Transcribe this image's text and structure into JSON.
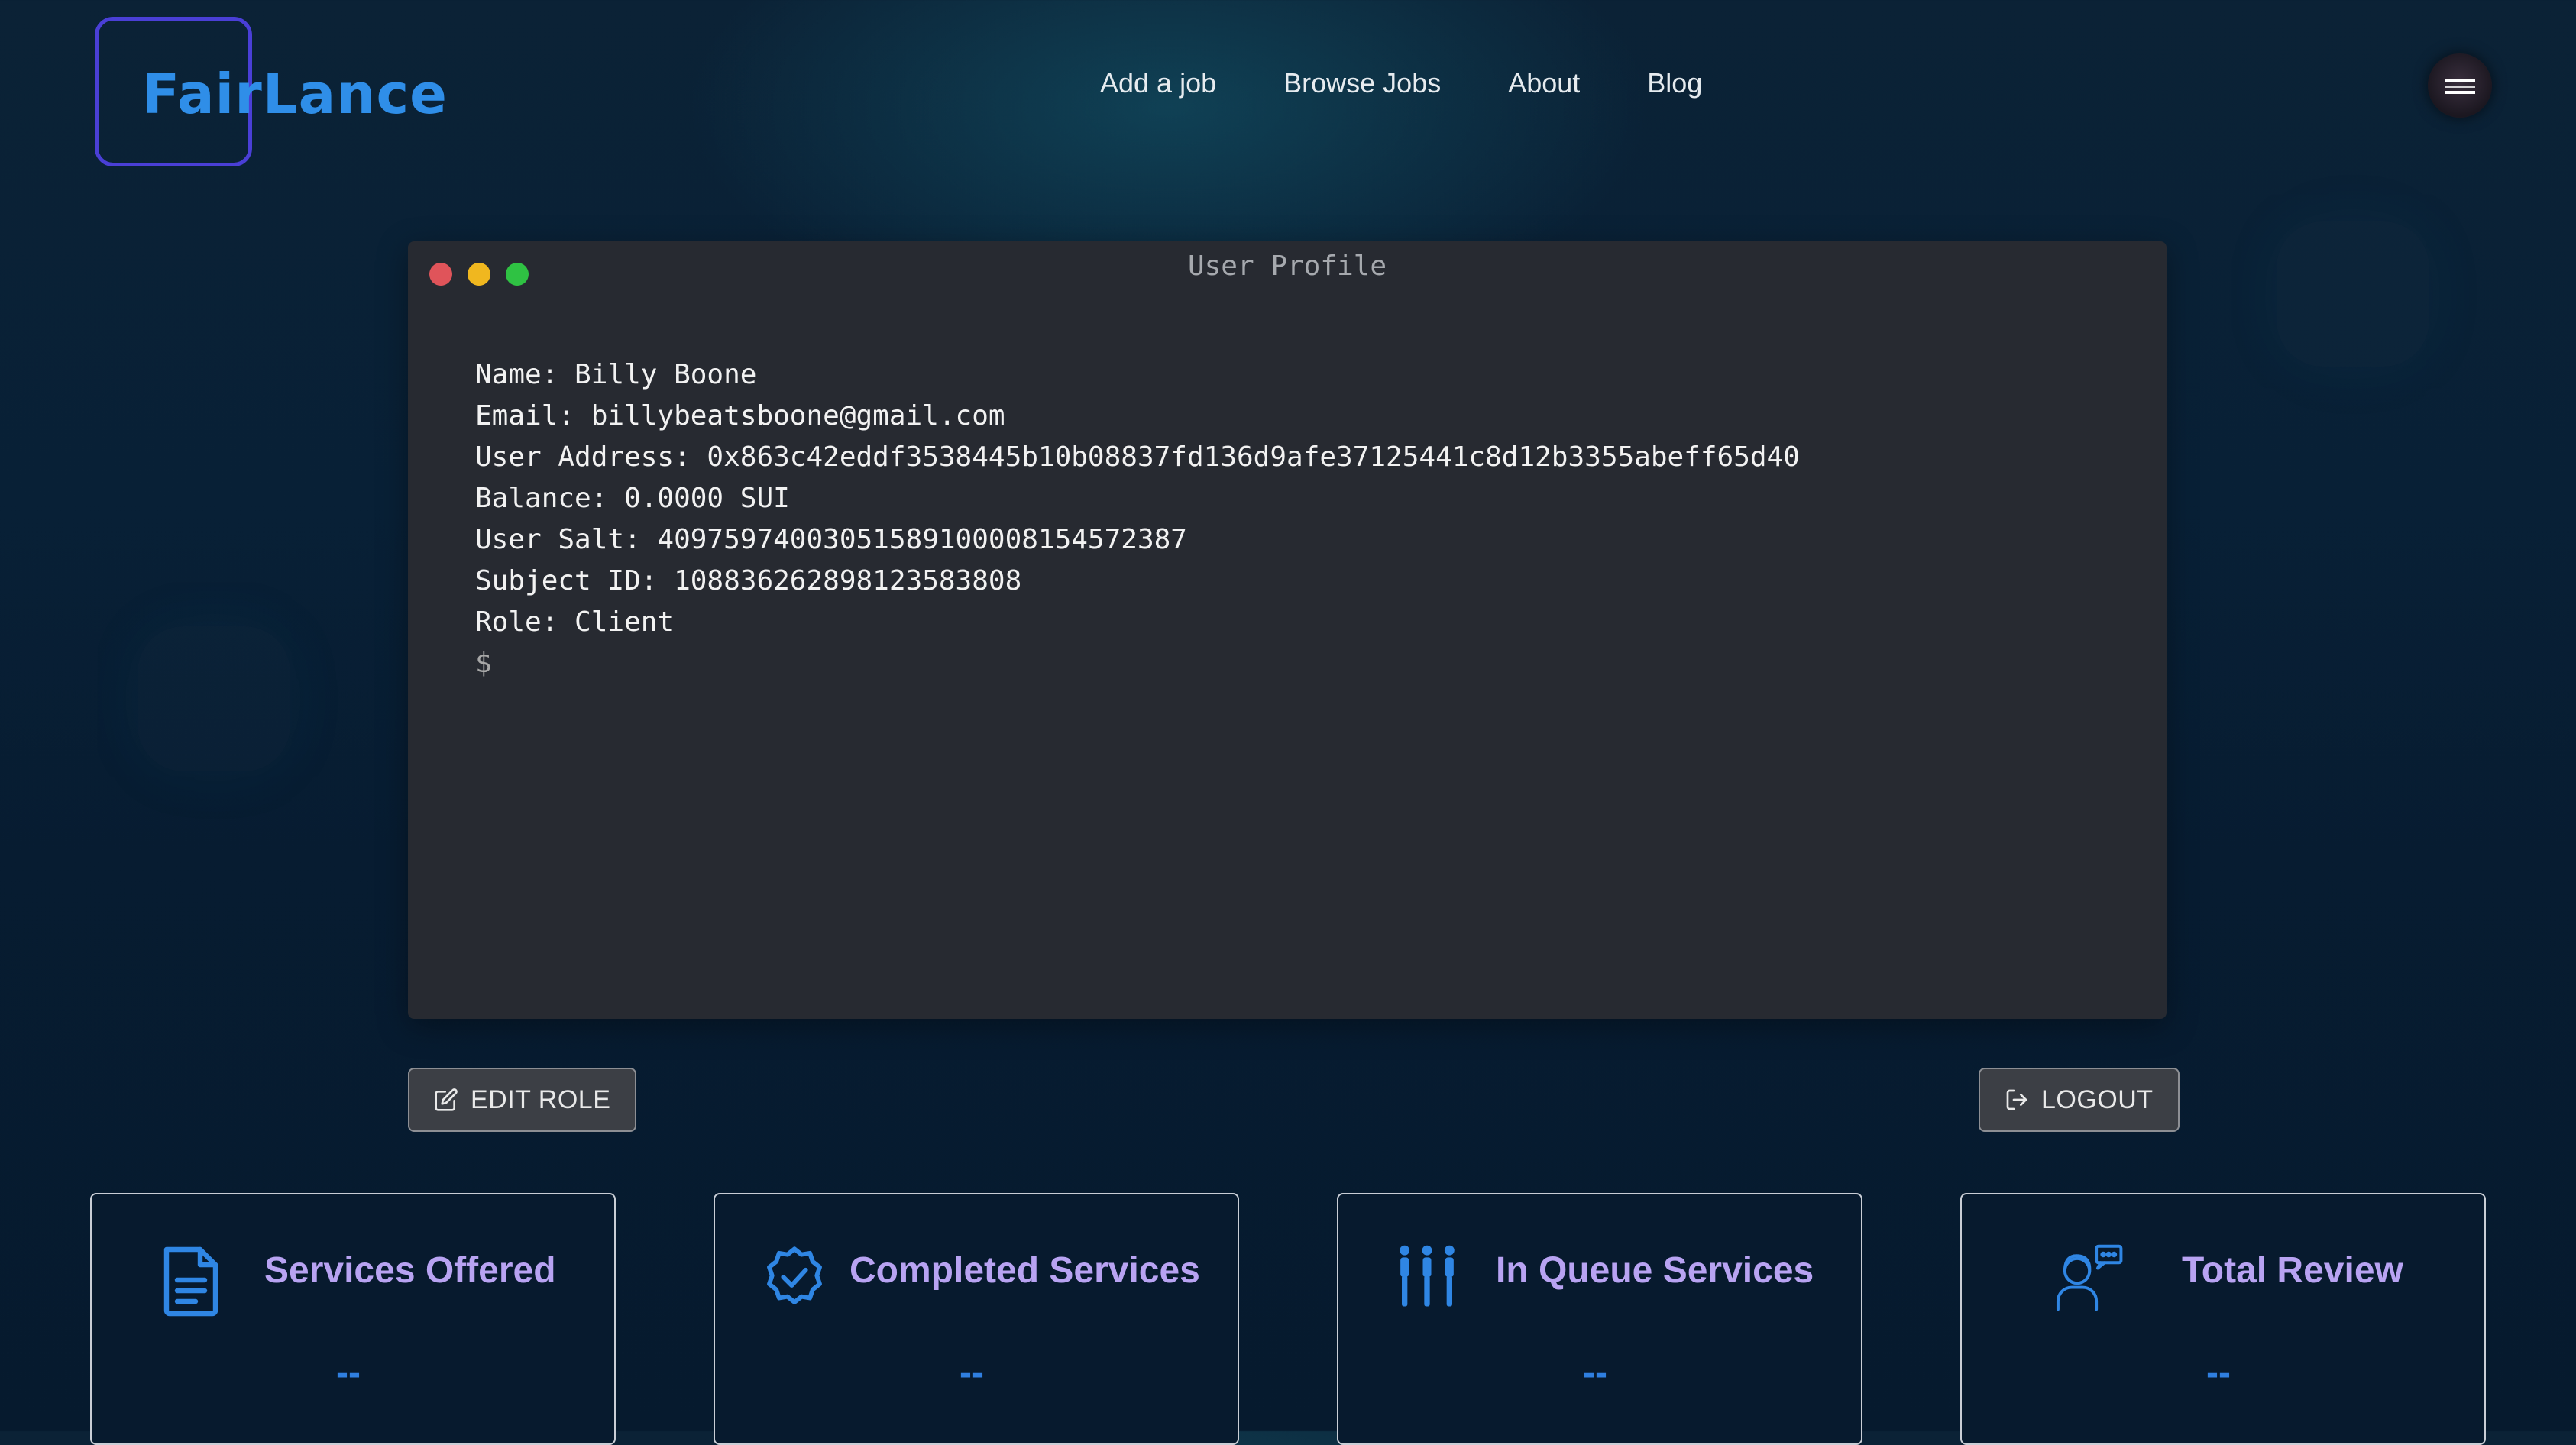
{
  "brand": {
    "name": "FairLance",
    "logo_color": "#2f8ee8",
    "frame_color": "#4a3fd6"
  },
  "nav": {
    "items": [
      {
        "label": "Add a job"
      },
      {
        "label": "Browse Jobs"
      },
      {
        "label": "About"
      },
      {
        "label": "Blog"
      }
    ]
  },
  "terminal": {
    "title": "User Profile",
    "lines": {
      "name": "Name: Billy Boone",
      "email": "Email: billybeatsboone@gmail.com",
      "address": "User Address: 0x863c42eddf3538445b10b08837fd136d9afe37125441c8d12b3355abeff65d40",
      "balance": "Balance: 0.0000 SUI",
      "salt": "User Salt: 40975974003051589100008154572387",
      "subject": "Subject ID: 108836262898123583808",
      "role": "Role: Client",
      "prompt": "$"
    },
    "window_dots": [
      "#e0545a",
      "#f0b71f",
      "#2fc243"
    ]
  },
  "actions": {
    "edit_role": "EDIT ROLE",
    "logout": "LOGOUT"
  },
  "stats": [
    {
      "title": "Services Offered",
      "value": "--",
      "icon": "document-icon"
    },
    {
      "title": "Completed Services",
      "value": "--",
      "icon": "verified-badge-icon"
    },
    {
      "title": "In Queue Services",
      "value": "--",
      "icon": "people-queue-icon"
    },
    {
      "title": "Total Review",
      "value": "--",
      "icon": "review-person-icon"
    }
  ],
  "colors": {
    "stat_title": "#b8a3f2",
    "stat_value": "#2f7fe0",
    "icon_blue": "#2f86e4"
  }
}
